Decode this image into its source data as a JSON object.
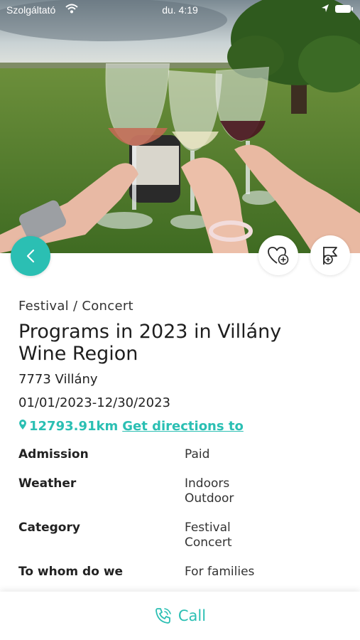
{
  "status_bar": {
    "carrier": "Szolgáltató",
    "time": "du. 4:19"
  },
  "event": {
    "category": "Festival / Concert",
    "title": "Programs in 2023 in Villány Wine Region",
    "address": "7773 Villány",
    "dates": "01/01/2023-12/30/2023",
    "distance": "12793.91km",
    "directions_label": "Get directions to"
  },
  "details": [
    {
      "label": "Admission",
      "values": [
        "Paid"
      ]
    },
    {
      "label": "Weather",
      "values": [
        "Indoors",
        "Outdoor"
      ]
    },
    {
      "label": "Category",
      "values": [
        "Festival",
        "Concert"
      ]
    },
    {
      "label": "To whom do we",
      "values": [
        "For families"
      ]
    }
  ],
  "actions": {
    "call_label": "Call"
  },
  "colors": {
    "accent": "#2bbfb3",
    "text": "#222222"
  },
  "icons": {
    "back": "chevron-left-icon",
    "favorite": "heart-plus-icon",
    "plan": "flag-plus-icon",
    "location": "map-pin-icon",
    "call": "phone-ringing-icon"
  }
}
